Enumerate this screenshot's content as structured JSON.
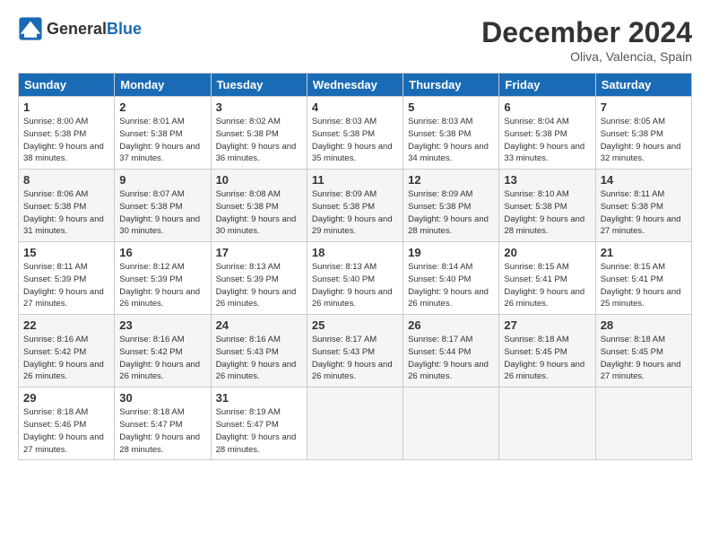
{
  "header": {
    "logo_general": "General",
    "logo_blue": "Blue",
    "title": "December 2024",
    "location": "Oliva, Valencia, Spain"
  },
  "days_of_week": [
    "Sunday",
    "Monday",
    "Tuesday",
    "Wednesday",
    "Thursday",
    "Friday",
    "Saturday"
  ],
  "weeks": [
    [
      {
        "day": "1",
        "sunrise": "8:00 AM",
        "sunset": "5:38 PM",
        "daylight": "9 hours and 38 minutes."
      },
      {
        "day": "2",
        "sunrise": "8:01 AM",
        "sunset": "5:38 PM",
        "daylight": "9 hours and 37 minutes."
      },
      {
        "day": "3",
        "sunrise": "8:02 AM",
        "sunset": "5:38 PM",
        "daylight": "9 hours and 36 minutes."
      },
      {
        "day": "4",
        "sunrise": "8:03 AM",
        "sunset": "5:38 PM",
        "daylight": "9 hours and 35 minutes."
      },
      {
        "day": "5",
        "sunrise": "8:03 AM",
        "sunset": "5:38 PM",
        "daylight": "9 hours and 34 minutes."
      },
      {
        "day": "6",
        "sunrise": "8:04 AM",
        "sunset": "5:38 PM",
        "daylight": "9 hours and 33 minutes."
      },
      {
        "day": "7",
        "sunrise": "8:05 AM",
        "sunset": "5:38 PM",
        "daylight": "9 hours and 32 minutes."
      }
    ],
    [
      {
        "day": "8",
        "sunrise": "8:06 AM",
        "sunset": "5:38 PM",
        "daylight": "9 hours and 31 minutes."
      },
      {
        "day": "9",
        "sunrise": "8:07 AM",
        "sunset": "5:38 PM",
        "daylight": "9 hours and 30 minutes."
      },
      {
        "day": "10",
        "sunrise": "8:08 AM",
        "sunset": "5:38 PM",
        "daylight": "9 hours and 30 minutes."
      },
      {
        "day": "11",
        "sunrise": "8:09 AM",
        "sunset": "5:38 PM",
        "daylight": "9 hours and 29 minutes."
      },
      {
        "day": "12",
        "sunrise": "8:09 AM",
        "sunset": "5:38 PM",
        "daylight": "9 hours and 28 minutes."
      },
      {
        "day": "13",
        "sunrise": "8:10 AM",
        "sunset": "5:38 PM",
        "daylight": "9 hours and 28 minutes."
      },
      {
        "day": "14",
        "sunrise": "8:11 AM",
        "sunset": "5:38 PM",
        "daylight": "9 hours and 27 minutes."
      }
    ],
    [
      {
        "day": "15",
        "sunrise": "8:11 AM",
        "sunset": "5:39 PM",
        "daylight": "9 hours and 27 minutes."
      },
      {
        "day": "16",
        "sunrise": "8:12 AM",
        "sunset": "5:39 PM",
        "daylight": "9 hours and 26 minutes."
      },
      {
        "day": "17",
        "sunrise": "8:13 AM",
        "sunset": "5:39 PM",
        "daylight": "9 hours and 26 minutes."
      },
      {
        "day": "18",
        "sunrise": "8:13 AM",
        "sunset": "5:40 PM",
        "daylight": "9 hours and 26 minutes."
      },
      {
        "day": "19",
        "sunrise": "8:14 AM",
        "sunset": "5:40 PM",
        "daylight": "9 hours and 26 minutes."
      },
      {
        "day": "20",
        "sunrise": "8:15 AM",
        "sunset": "5:41 PM",
        "daylight": "9 hours and 26 minutes."
      },
      {
        "day": "21",
        "sunrise": "8:15 AM",
        "sunset": "5:41 PM",
        "daylight": "9 hours and 25 minutes."
      }
    ],
    [
      {
        "day": "22",
        "sunrise": "8:16 AM",
        "sunset": "5:42 PM",
        "daylight": "9 hours and 26 minutes."
      },
      {
        "day": "23",
        "sunrise": "8:16 AM",
        "sunset": "5:42 PM",
        "daylight": "9 hours and 26 minutes."
      },
      {
        "day": "24",
        "sunrise": "8:16 AM",
        "sunset": "5:43 PM",
        "daylight": "9 hours and 26 minutes."
      },
      {
        "day": "25",
        "sunrise": "8:17 AM",
        "sunset": "5:43 PM",
        "daylight": "9 hours and 26 minutes."
      },
      {
        "day": "26",
        "sunrise": "8:17 AM",
        "sunset": "5:44 PM",
        "daylight": "9 hours and 26 minutes."
      },
      {
        "day": "27",
        "sunrise": "8:18 AM",
        "sunset": "5:45 PM",
        "daylight": "9 hours and 26 minutes."
      },
      {
        "day": "28",
        "sunrise": "8:18 AM",
        "sunset": "5:45 PM",
        "daylight": "9 hours and 27 minutes."
      }
    ],
    [
      {
        "day": "29",
        "sunrise": "8:18 AM",
        "sunset": "5:46 PM",
        "daylight": "9 hours and 27 minutes."
      },
      {
        "day": "30",
        "sunrise": "8:18 AM",
        "sunset": "5:47 PM",
        "daylight": "9 hours and 28 minutes."
      },
      {
        "day": "31",
        "sunrise": "8:19 AM",
        "sunset": "5:47 PM",
        "daylight": "9 hours and 28 minutes."
      },
      null,
      null,
      null,
      null
    ]
  ]
}
